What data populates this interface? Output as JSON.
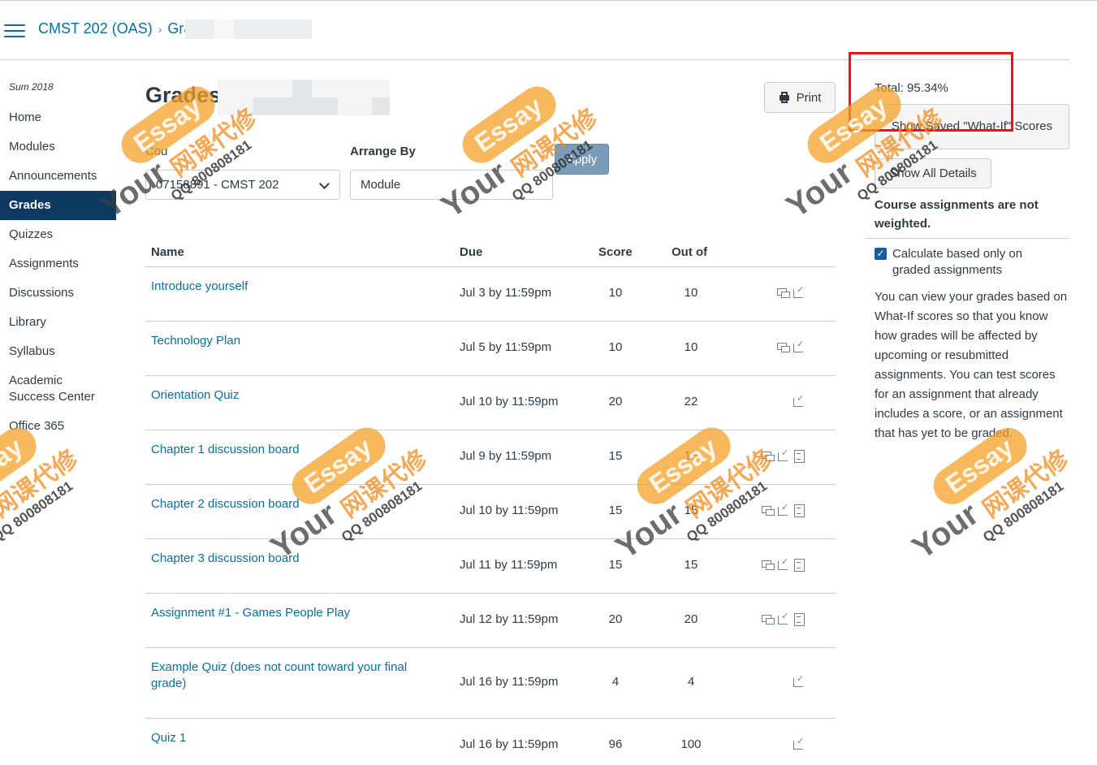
{
  "header": {
    "course": "CMST 202 (OAS)",
    "breadcrumb_current": "Gra"
  },
  "sidebar": {
    "term": "Sum 2018",
    "items": [
      {
        "label": "Home"
      },
      {
        "label": "Modules"
      },
      {
        "label": "Announcements"
      },
      {
        "label": "Grades"
      },
      {
        "label": "Quizzes"
      },
      {
        "label": "Assignments"
      },
      {
        "label": "Discussions"
      },
      {
        "label": "Library"
      },
      {
        "label": "Syllabus"
      },
      {
        "label": "Academic Success Center"
      },
      {
        "label": "Office 365"
      }
    ]
  },
  "main": {
    "title": "Grades",
    "print_label": "Print",
    "course_label": "Cou",
    "course_value": "07158891 - CMST 202",
    "arrange_label": "Arrange By",
    "arrange_value": "Module",
    "apply_label": "Apply",
    "columns": {
      "name": "Name",
      "due": "Due",
      "score": "Score",
      "outof": "Out of"
    },
    "rows": [
      {
        "name": "Introduce yourself",
        "due": "Jul 3 by 11:59pm",
        "score": "10",
        "outof": "10"
      },
      {
        "name": "Technology Plan",
        "due": "Jul 5 by 11:59pm",
        "score": "10",
        "outof": "10"
      },
      {
        "name": "Orientation Quiz",
        "due": "Jul 10 by 11:59pm",
        "score": "20",
        "outof": "22"
      },
      {
        "name": "Chapter 1 discussion board",
        "due": "Jul 9 by 11:59pm",
        "score": "15",
        "outof": "15"
      },
      {
        "name": "Chapter 2 discussion board",
        "due": "Jul 10 by 11:59pm",
        "score": "15",
        "outof": "15"
      },
      {
        "name": "Chapter 3 discussion board",
        "due": "Jul 11 by 11:59pm",
        "score": "15",
        "outof": "15"
      },
      {
        "name": "Assignment #1 - Games People Play",
        "due": "Jul 12 by 11:59pm",
        "score": "20",
        "outof": "20"
      },
      {
        "name": "Example Quiz (does not count toward your final grade)",
        "due": "Jul 16 by 11:59pm",
        "score": "4",
        "outof": "4"
      },
      {
        "name": "Quiz 1",
        "due": "Jul 16 by 11:59pm",
        "score": "96",
        "outof": "100"
      }
    ]
  },
  "right": {
    "total": "Total: 95.34%",
    "whatif_button": "Show Saved \"What-If\" Scores",
    "show_all": "Show All Details",
    "weight_note": "Course assignments are not weighted.",
    "calc_label": "Calculate based only on graded assignments",
    "info": "You can view your grades based on What-If scores so that you know how grades will be affected by upcoming or resubmitted assignments. You can test scores for an assignment that already includes a score, or an assignment that has yet to be graded."
  },
  "watermark": {
    "word1": "Your",
    "word2": "Essay",
    "cn": "网课代修",
    "qq": "QQ 800808181",
    "color": "#f5a028"
  },
  "colors": {
    "link": "#0770a3",
    "nav_active": "#0e3a62",
    "highlight": "#e8141c"
  }
}
